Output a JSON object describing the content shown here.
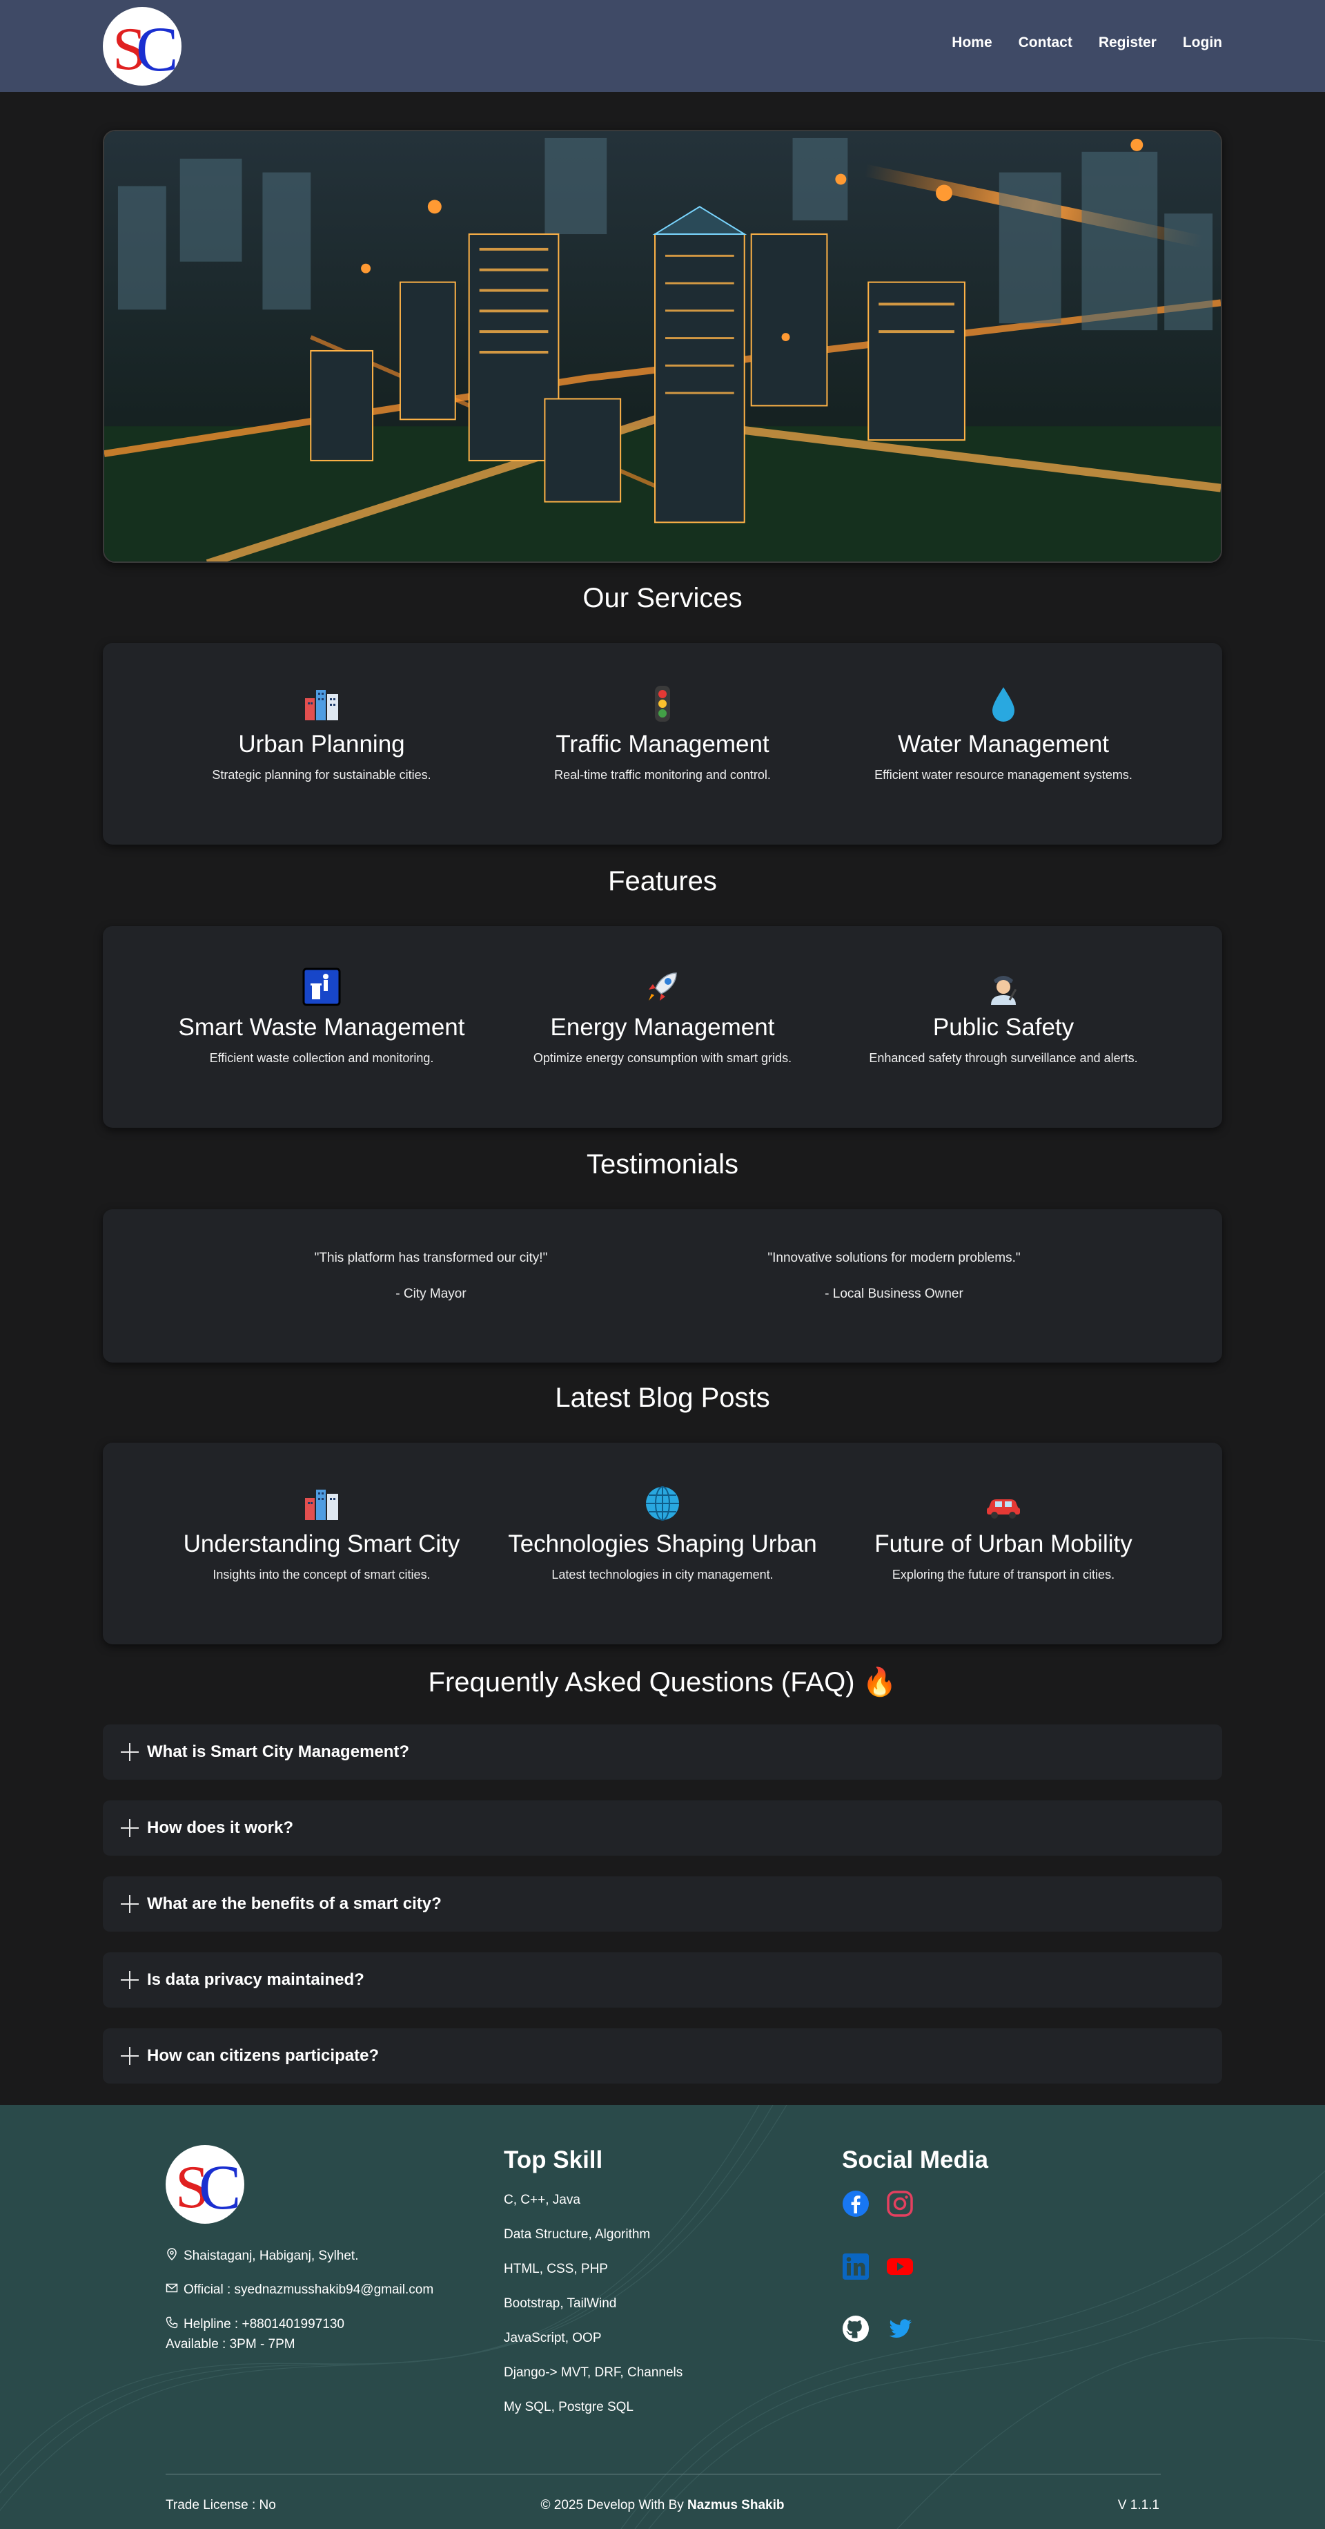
{
  "header": {
    "logo_text": "SC",
    "nav": [
      "Home",
      "Contact",
      "Register",
      "Login"
    ]
  },
  "services": {
    "title": "Our Services",
    "items": [
      {
        "icon": "city-icon",
        "title": "Urban Planning",
        "desc": "Strategic planning for sustainable cities."
      },
      {
        "icon": "traffic-light-icon",
        "title": "Traffic Management",
        "desc": "Real-time traffic monitoring and control."
      },
      {
        "icon": "water-drop-icon",
        "title": "Water Management",
        "desc": "Efficient water resource management systems."
      }
    ]
  },
  "features": {
    "title": "Features",
    "items": [
      {
        "icon": "waste-bin-icon",
        "title": "Smart Waste Management",
        "desc": "Efficient waste collection and monitoring."
      },
      {
        "icon": "rocket-icon",
        "title": "Energy Management",
        "desc": "Optimize energy consumption with smart grids."
      },
      {
        "icon": "police-officer-icon",
        "title": "Public Safety",
        "desc": "Enhanced safety through surveillance and alerts."
      }
    ]
  },
  "testimonials": {
    "title": "Testimonials",
    "items": [
      {
        "quote": "\"This platform has transformed our city!\"",
        "author": "- City Mayor"
      },
      {
        "quote": "\"Innovative solutions for modern problems.\"",
        "author": "- Local Business Owner"
      }
    ]
  },
  "blog": {
    "title": "Latest Blog Posts",
    "items": [
      {
        "icon": "city-icon",
        "title": "Understanding Smart City",
        "desc": "Insights into the concept of smart cities."
      },
      {
        "icon": "globe-icon",
        "title": "Technologies Shaping Urban",
        "desc": "Latest technologies in city management."
      },
      {
        "icon": "car-icon",
        "title": "Future of Urban Mobility",
        "desc": "Exploring the future of transport in cities."
      }
    ]
  },
  "faq": {
    "title": "Frequently Asked Questions (FAQ) 🔥",
    "items": [
      "What is Smart City Management?",
      "How does it work?",
      "What are the benefits of a smart city?",
      "Is data privacy maintained?",
      "How can citizens participate?"
    ]
  },
  "footer": {
    "address": "Shaistaganj, Habiganj, Sylhet.",
    "email": "Official : syednazmusshakib94@gmail.com",
    "helpline": "Helpline : +8801401997130",
    "available": "Available : 3PM - 7PM",
    "skills_title": "Top Skill",
    "skills": [
      "C, C++, Java",
      "Data Structure, Algorithm",
      "HTML, CSS, PHP",
      "Bootstrap, TailWind",
      "JavaScript, OOP",
      "Django-> MVT, DRF, Channels",
      "My SQL, Postgre SQL"
    ],
    "social_title": "Social Media",
    "trade_license": "Trade License : No",
    "copyright_prefix": "© 2025 Develop With By ",
    "copyright_name": "Nazmus Shakib",
    "version": "V 1.1.1"
  }
}
